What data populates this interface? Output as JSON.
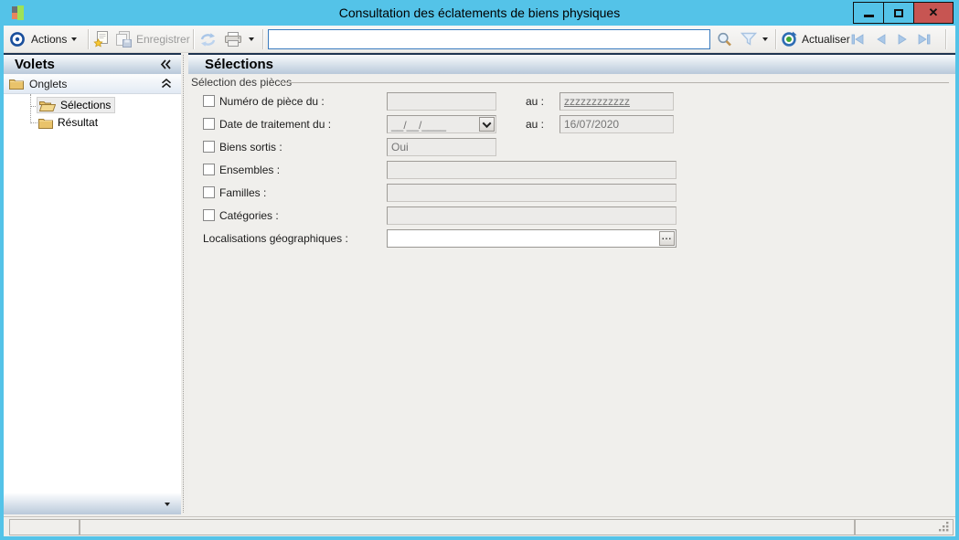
{
  "window": {
    "title": "Consultation des éclatements de biens physiques",
    "controls": {
      "minimize": "minimize",
      "maximize": "maximize",
      "close": "✕"
    }
  },
  "toolbar": {
    "actions_label": "Actions",
    "enregistrer_label": "Enregistrer",
    "search_value": "",
    "actualiser_label": "Actualiser"
  },
  "sidebar": {
    "title": "Volets",
    "group_label": "Onglets",
    "items": [
      {
        "label": "Sélections",
        "selected": true
      },
      {
        "label": "Résultat",
        "selected": false
      }
    ]
  },
  "main": {
    "title": "Sélections",
    "group_title": "Sélection des pièces",
    "fields": {
      "numero": {
        "label": "Numéro de pièce du :",
        "value": "",
        "au_label": "au :",
        "au_value": "zzzzzzzzzzzz"
      },
      "date": {
        "label": "Date de traitement du :",
        "value": "__/__/____",
        "au_label": "au :",
        "au_value": "16/07/2020"
      },
      "biens": {
        "label": "Biens sortis :",
        "value": "Oui"
      },
      "ensembles": {
        "label": "Ensembles :",
        "value": ""
      },
      "familles": {
        "label": "Familles :",
        "value": ""
      },
      "categories": {
        "label": "Catégories :",
        "value": ""
      },
      "localisations": {
        "label": "Localisations géographiques :",
        "value": "",
        "browse_label": "..."
      }
    }
  },
  "icons": {
    "app_logo": "colored-squares",
    "actions": "target-circle",
    "new_doc": "document-star",
    "save": "copy-pages-save",
    "refresh": "sync-arrows",
    "print": "printer",
    "search": "magnifier",
    "filter": "funnel",
    "actualiser": "refresh-globe",
    "nav_first": "first-arrow",
    "nav_prev": "prev-arrow",
    "nav_next": "next-arrow",
    "nav_last": "last-arrow",
    "collapse_left": "chevrons-left",
    "collapse_up": "chevrons-up",
    "folder": "folder",
    "browse": "ellipsis"
  },
  "colors": {
    "titlebar": "#54c3e8",
    "close_button": "#c75552",
    "header_top_line": "#1e3450",
    "header_gradient_bottom": "#b9c9da",
    "search_border": "#3a7bbf"
  }
}
